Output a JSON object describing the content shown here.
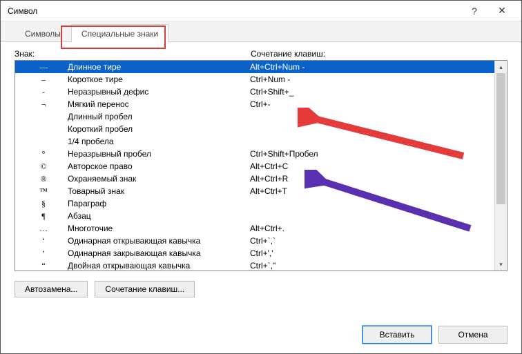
{
  "window": {
    "title": "Символ",
    "help_hint": "?",
    "close_hint": "✕"
  },
  "tabs": {
    "syms": "Символы",
    "special": "Специальные знаки"
  },
  "headers": {
    "sign": "Знак:",
    "shortcut": "Сочетание клавиш:"
  },
  "rows": [
    {
      "sym": "—",
      "name": "Длинное тире",
      "key": "Alt+Ctrl+Num -",
      "selected": true
    },
    {
      "sym": "–",
      "name": "Короткое тире",
      "key": "Ctrl+Num -"
    },
    {
      "sym": "-",
      "name": "Неразрывный дефис",
      "key": "Ctrl+Shift+_"
    },
    {
      "sym": "¬",
      "name": "Мягкий перенос",
      "key": "Ctrl+-"
    },
    {
      "sym": "",
      "name": "Длинный пробел",
      "key": ""
    },
    {
      "sym": "",
      "name": "Короткий пробел",
      "key": ""
    },
    {
      "sym": "",
      "name": "1/4 пробела",
      "key": ""
    },
    {
      "sym": "°",
      "name": "Неразрывный пробел",
      "key": "Ctrl+Shift+Пробел"
    },
    {
      "sym": "©",
      "name": "Авторское право",
      "key": "Alt+Ctrl+C"
    },
    {
      "sym": "®",
      "name": "Охраняемый знак",
      "key": "Alt+Ctrl+R"
    },
    {
      "sym": "™",
      "name": "Товарный знак",
      "key": "Alt+Ctrl+T"
    },
    {
      "sym": "§",
      "name": "Параграф",
      "key": ""
    },
    {
      "sym": "¶",
      "name": "Абзац",
      "key": ""
    },
    {
      "sym": "…",
      "name": "Многоточие",
      "key": "Alt+Ctrl+."
    },
    {
      "sym": "‘",
      "name": "Одинарная открывающая кавычка",
      "key": "Ctrl+`,`"
    },
    {
      "sym": "’",
      "name": "Одинарная закрывающая кавычка",
      "key": "Ctrl+','"
    },
    {
      "sym": "“",
      "name": "Двойная открывающая кавычка",
      "key": "Ctrl+`,\""
    }
  ],
  "buttons": {
    "autocorrect": "Автозамена...",
    "shortcut": "Сочетание клавиш...",
    "insert": "Вставить",
    "cancel": "Отмена"
  }
}
